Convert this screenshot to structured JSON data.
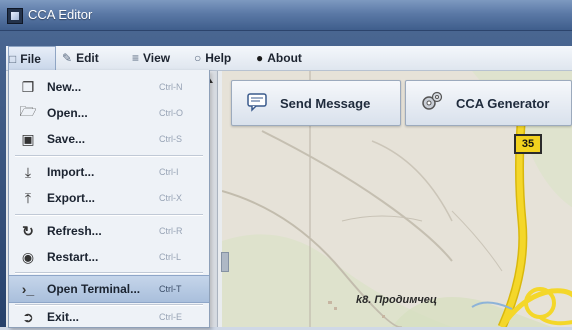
{
  "window": {
    "title": "CCA Editor"
  },
  "menubar": {
    "items": [
      {
        "label": "File",
        "icon": "file-icon"
      },
      {
        "label": "Edit",
        "icon": "edit-icon"
      },
      {
        "label": "View",
        "icon": "view-icon"
      },
      {
        "label": "Help",
        "icon": "help-icon"
      },
      {
        "label": "About",
        "icon": "about-icon"
      }
    ]
  },
  "file_menu": {
    "items": [
      {
        "label": "New...",
        "shortcut": "Ctrl-N",
        "icon": "new-icon"
      },
      {
        "label": "Open...",
        "shortcut": "Ctrl-O",
        "icon": "open-icon"
      },
      {
        "label": "Save...",
        "shortcut": "Ctrl-S",
        "icon": "save-icon"
      },
      {
        "label": "Import...",
        "shortcut": "Ctrl-I",
        "icon": "import-icon"
      },
      {
        "label": "Export...",
        "shortcut": "Ctrl-X",
        "icon": "export-icon"
      },
      {
        "label": "Refresh...",
        "shortcut": "Ctrl-R",
        "icon": "refresh-icon"
      },
      {
        "label": "Restart...",
        "shortcut": "Ctrl-L",
        "icon": "restart-icon"
      },
      {
        "label": "Open Terminal...",
        "shortcut": "Ctrl-T",
        "icon": "terminal-icon",
        "highlighted": true
      },
      {
        "label": "Exit...",
        "shortcut": "Ctrl-E",
        "icon": "exit-icon"
      }
    ]
  },
  "toolbar": {
    "send_message": "Send Message",
    "cca_generator": "CCA Generator"
  },
  "map": {
    "road_number": "35",
    "place_label": "k8. Продимчец",
    "road_color": "#f2d21e"
  }
}
